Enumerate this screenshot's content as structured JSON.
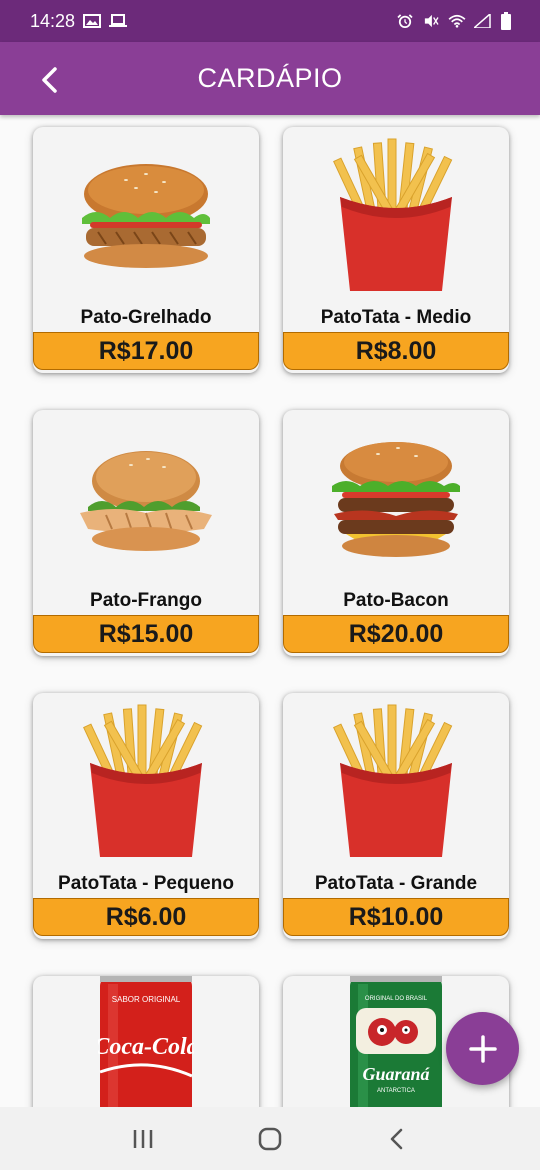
{
  "status_bar": {
    "time": "14:28",
    "icons": [
      "image-icon",
      "laptop-icon",
      "alarm-icon",
      "mute-icon",
      "wifi-icon",
      "signal-icon",
      "battery-icon"
    ]
  },
  "app_bar": {
    "title": "CARDÁPIO",
    "back_icon": "chevron-left-icon"
  },
  "menu": [
    {
      "name": "Pato-Grelhado",
      "price": "R$17.00",
      "image": "burger-grilled"
    },
    {
      "name": "PatoTata - Medio",
      "price": "R$8.00",
      "image": "fries"
    },
    {
      "name": "Pato-Frango",
      "price": "R$15.00",
      "image": "burger-chicken"
    },
    {
      "name": "Pato-Bacon",
      "price": "R$20.00",
      "image": "burger-bacon"
    },
    {
      "name": "PatoTata - Pequeno",
      "price": "R$6.00",
      "image": "fries"
    },
    {
      "name": "PatoTata - Grande",
      "price": "R$10.00",
      "image": "fries"
    },
    {
      "name": "",
      "price": "",
      "image": "coca-cola-can",
      "label": "Coca-Cola",
      "sublabel": "SABOR ORIGINAL"
    },
    {
      "name": "",
      "price": "",
      "image": "guarana-can",
      "label": "Guaraná",
      "sublabel": "ORIGINAL DO BRASIL",
      "sublabel2": "ANTARCTICA"
    }
  ],
  "fab": {
    "icon": "plus-icon"
  },
  "nav_bar": {
    "icons": [
      "recent-apps-icon",
      "home-icon",
      "back-icon"
    ]
  },
  "colors": {
    "status_bar": "#6c2a7a",
    "app_bar": "#8a3e96",
    "price_band": "#f7a520",
    "fab": "#8a3e96"
  }
}
